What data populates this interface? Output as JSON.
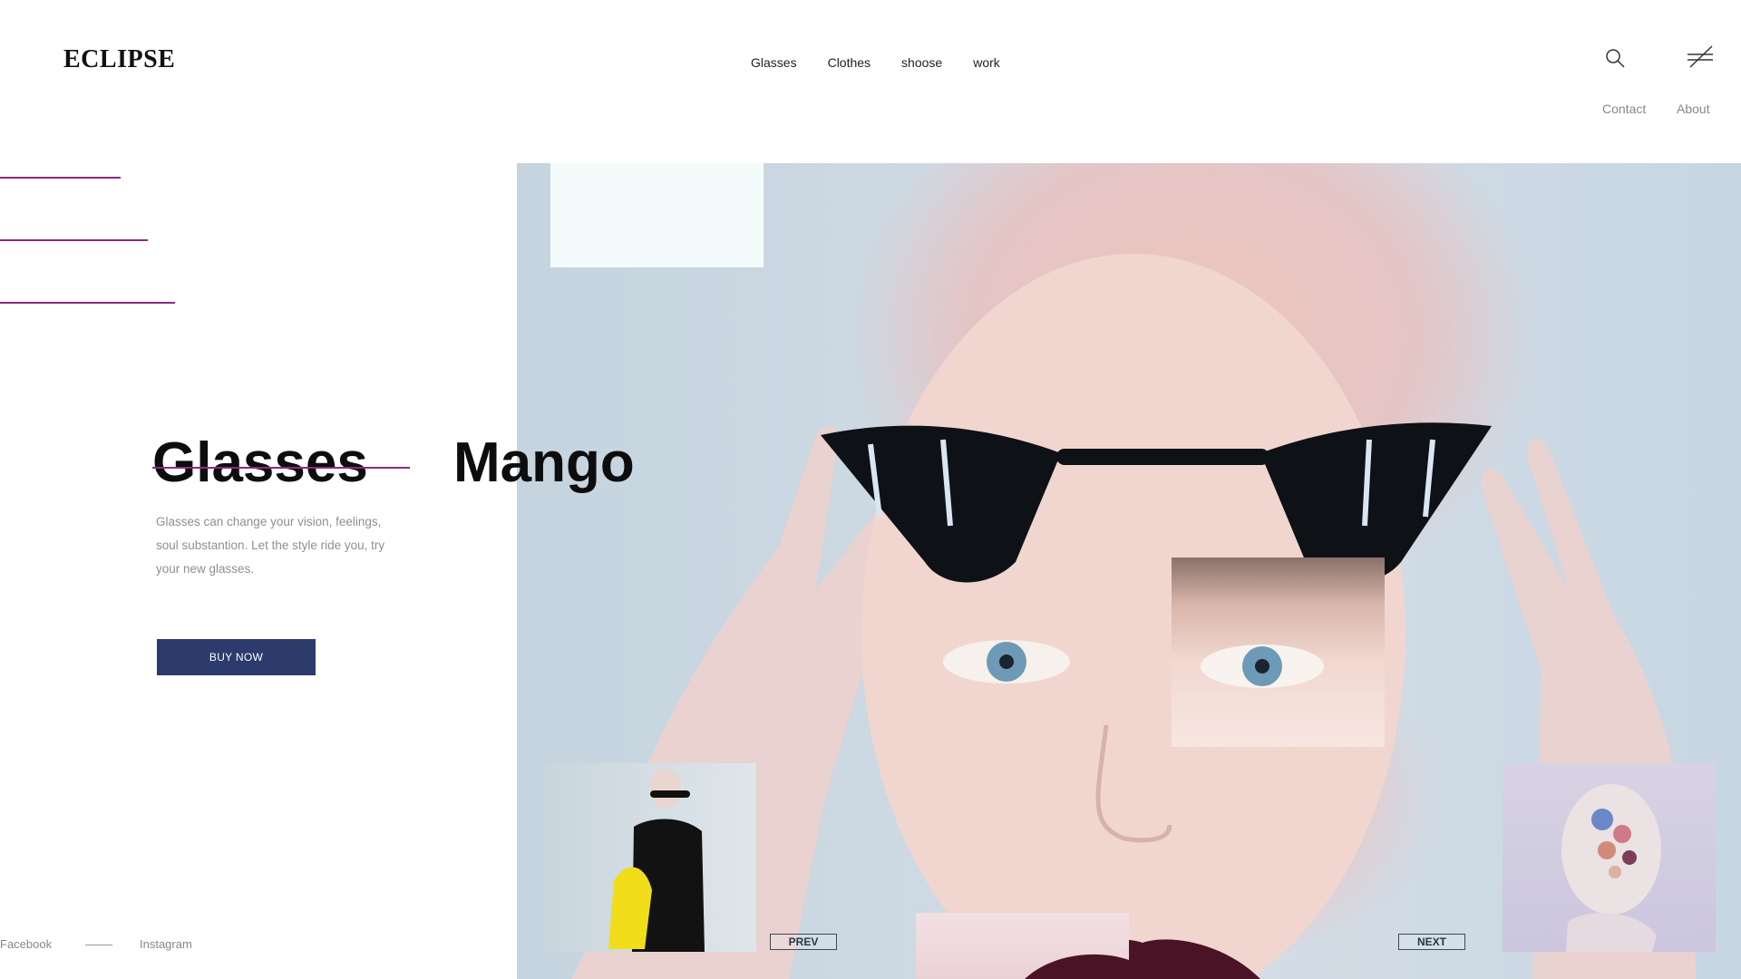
{
  "header": {
    "logo": "ECLIPSE",
    "nav": [
      "Glasses",
      "Clothes",
      "shoose",
      "work"
    ],
    "secondary_nav": {
      "contact": "Contact",
      "about": "About"
    },
    "icons": {
      "search": "search-icon",
      "menu": "menu-icon"
    }
  },
  "hero": {
    "title_left": "Glasses",
    "title_right": "Mango",
    "description": "Glasses can change your vision, feelings, soul substantion. Let the style ride you, try your  new glasses.",
    "buy_button": "BUY NOW"
  },
  "gallery": {
    "prev_label": "PREV",
    "next_label": "NEXT"
  },
  "social": {
    "facebook": "Facebook",
    "instagram": "Instagram"
  },
  "colors": {
    "accent": "#8b2a7c",
    "button": "#2d3a6c"
  }
}
